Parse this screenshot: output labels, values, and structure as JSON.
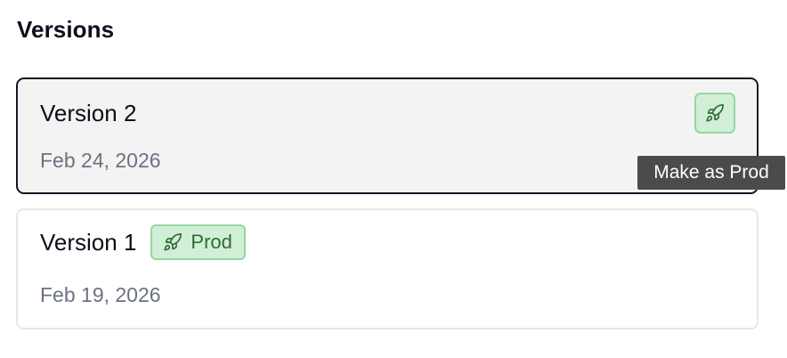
{
  "section": {
    "title": "Versions"
  },
  "versions": [
    {
      "title": "Version 2",
      "date": "Feb 24, 2026",
      "selected": true,
      "action": {
        "icon": "rocket-icon",
        "tooltip": "Make as Prod"
      }
    },
    {
      "title": "Version 1",
      "date": "Feb 19, 2026",
      "selected": false,
      "badge": {
        "icon": "rocket-icon",
        "label": "Prod"
      }
    }
  ],
  "colors": {
    "badge_bg": "#d1efd6",
    "badge_border": "#96d6a1",
    "badge_text": "#2f6b35",
    "selected_border": "#111827",
    "selected_bg": "#f3f3f3",
    "muted_text": "#6b7280",
    "tooltip_bg": "#4b4b4b"
  }
}
